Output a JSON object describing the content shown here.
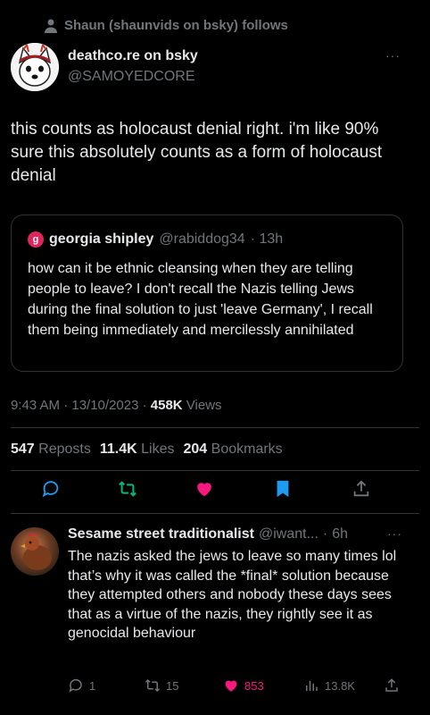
{
  "social_context": {
    "text": "Shaun (shaunvids on bsky) follows",
    "icon": "person-icon"
  },
  "tweet": {
    "author_name": "deathco.re on bsky",
    "author_handle": "@SAMOYEDCORE",
    "more": "···",
    "text": "this counts as holocaust denial right. i'm like 90% sure this absolutely counts as a form of holocaust denial",
    "quote": {
      "avatar_letter": "g",
      "author_name": "georgia shipley",
      "author_handle": "@rabiddog34",
      "time": "· 13h",
      "text": "how can it be ethnic cleansing when they are telling people to leave? I don't recall the Nazis telling Jews during the final solution to just 'leave Germany', I recall them being immediately and mercilessly annihilated"
    },
    "timestamp": "9:43 AM · 13/10/2023 · ",
    "views_count": "458K",
    "views_label": " Views",
    "stats": {
      "reposts_count": "547",
      "reposts_label": "Reposts",
      "likes_count": "11.4K",
      "likes_label": "Likes",
      "bookmarks_count": "204",
      "bookmarks_label": "Bookmarks"
    },
    "colors": {
      "repost": "#00ba7c",
      "like": "#f91880",
      "bookmark": "#1d9bf0",
      "muted": "#71767b"
    }
  },
  "reply": {
    "author_name": "Sesame street traditionalist",
    "author_handle": "@iwant...",
    "dot": "·",
    "time": "6h",
    "more": "···",
    "text": "The nazis asked the jews to leave so many times lol that’s why it was called the *final* solution because they attempted others and nobody these days sees that as a virtue of the nazis, they rightly see it as genocidal behaviour",
    "replies": "1",
    "reposts": "15",
    "likes": "853",
    "views": "13.8K"
  }
}
